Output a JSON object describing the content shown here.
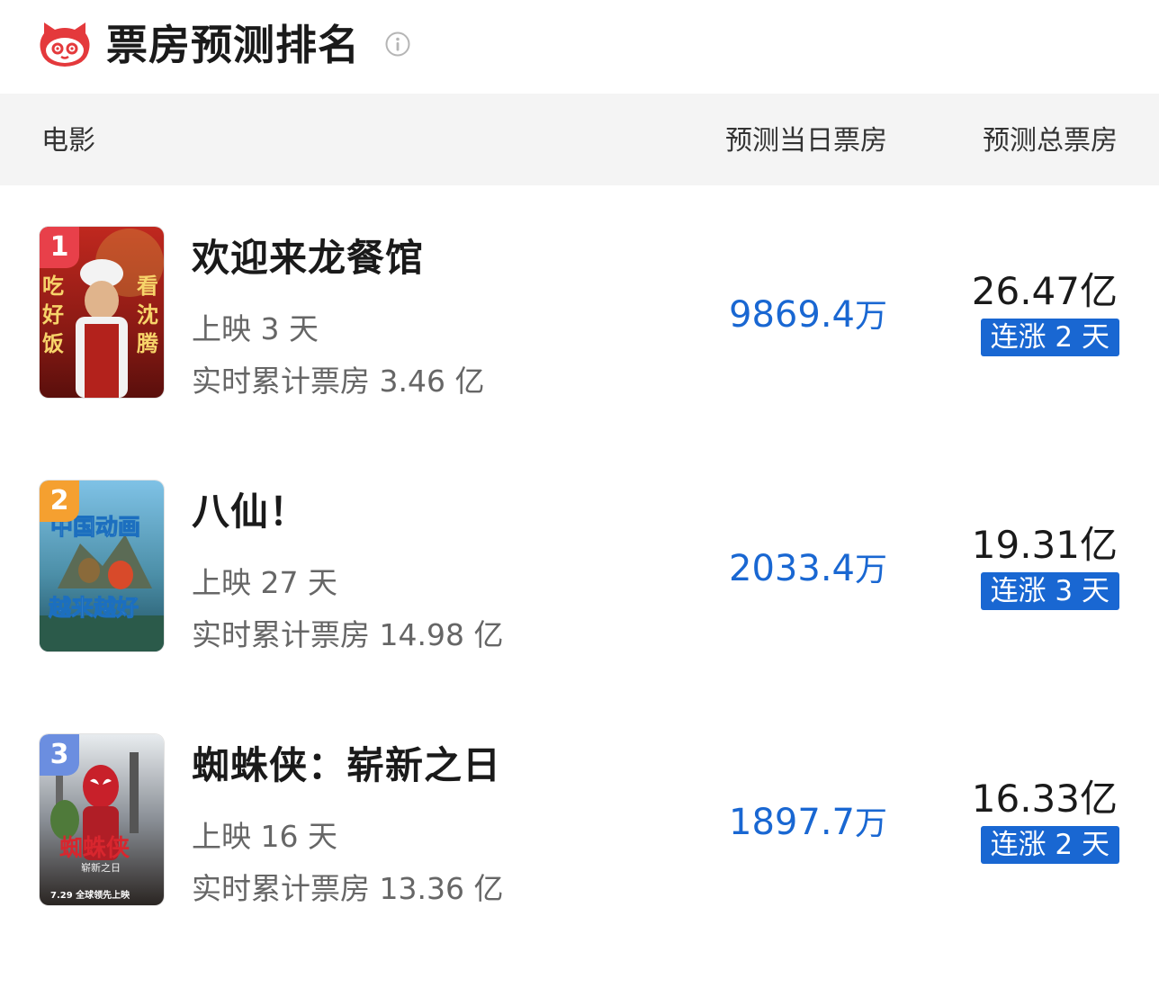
{
  "header": {
    "title": "票房预测排名",
    "logo_icon": "maoyan-cat-logo",
    "info_icon": "info-icon"
  },
  "columns": {
    "movie": "电影",
    "daily": "预测当日票房",
    "total": "预测总票房"
  },
  "colors": {
    "accent_blue": "#1967d2",
    "logo_red": "#e4393c",
    "rank1": "#e8404a",
    "rank2": "#f5a030",
    "rank3": "#6b8ee0"
  },
  "movies": [
    {
      "rank": "1",
      "name": "欢迎来龙餐馆",
      "days": "上映 3 天",
      "cumulative": "实时累计票房 3.46 亿",
      "daily_value": "9869.4",
      "daily_unit": "万",
      "total": "26.47亿",
      "streak": "连涨 2 天",
      "poster_text_left": "吃好饭",
      "poster_text_right": "看沈腾"
    },
    {
      "rank": "2",
      "name": "八仙！",
      "days": "上映 27 天",
      "cumulative": "实时累计票房 14.98 亿",
      "daily_value": "2033.4",
      "daily_unit": "万",
      "total": "19.31亿",
      "streak": "连涨 3 天",
      "poster_text_top": "中国动画",
      "poster_text_bottom": "越来越好"
    },
    {
      "rank": "3",
      "name": "蜘蛛侠：崭新之日",
      "days": "上映 16 天",
      "cumulative": "实时累计票房 13.36 亿",
      "daily_value": "1897.7",
      "daily_unit": "万",
      "total": "16.33亿",
      "streak": "连涨 2 天",
      "poster_title": "蜘蛛侠",
      "poster_subtitle": "崭新之日",
      "poster_date": "7.29 全球领先上映"
    }
  ]
}
